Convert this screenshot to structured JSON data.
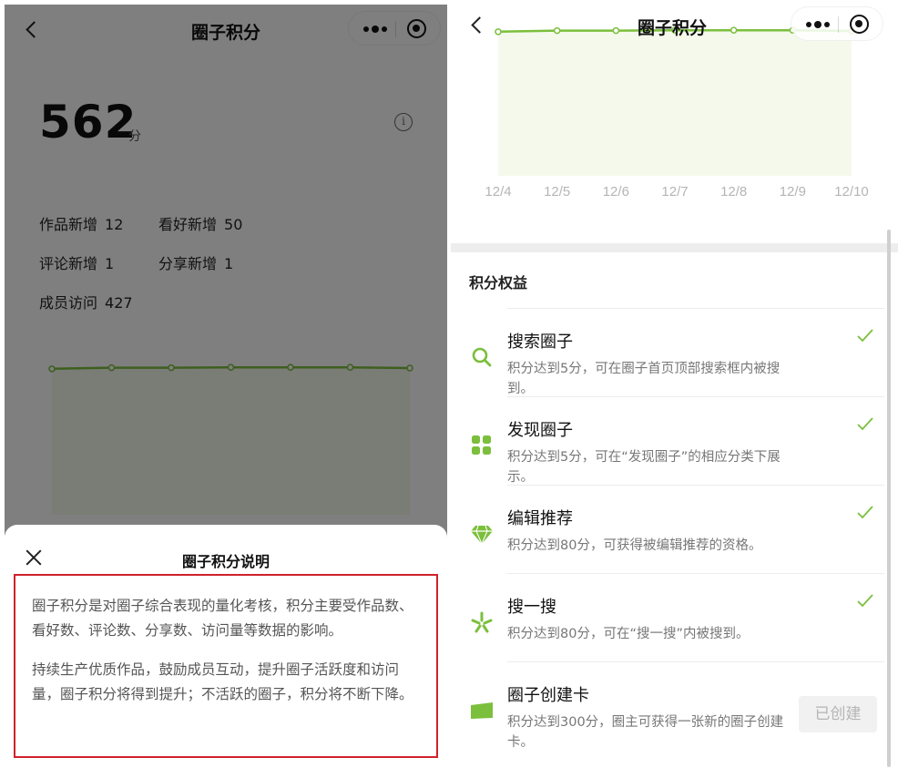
{
  "left": {
    "header": {
      "title": "圈子积分"
    },
    "score": {
      "value": "562",
      "unit": "分"
    },
    "info_icon": "info-icon",
    "stats": [
      {
        "label": "作品新增",
        "value": "12"
      },
      {
        "label": "看好新增",
        "value": "50"
      },
      {
        "label": "评论新增",
        "value": "1"
      },
      {
        "label": "分享新增",
        "value": "1"
      },
      {
        "label": "成员访问",
        "value": "427"
      }
    ],
    "sheet": {
      "title": "圈子积分说明",
      "paragraphs": [
        "圈子积分是对圈子综合表现的量化考核，积分主要受作品数、看好数、评论数、分享数、访问量等数据的影响。",
        "持续生产优质作品，鼓励成员互动，提升圈子活跃度和访问量，圈子积分将得到提升；不活跃的圈子，积分将不断下降。"
      ]
    }
  },
  "right": {
    "header": {
      "title": "圈子积分"
    },
    "section_title": "积分权益",
    "benefits": [
      {
        "title": "搜索圈子",
        "desc": "积分达到5分，可在圈子首页顶部搜索框内被搜到。",
        "icon": "search-icon",
        "status": "check"
      },
      {
        "title": "发现圈子",
        "desc": "积分达到5分，可在“发现圈子”的相应分类下展示。",
        "icon": "grid-icon",
        "status": "check"
      },
      {
        "title": "编辑推荐",
        "desc": "积分达到80分，可获得被编辑推荐的资格。",
        "icon": "diamond-icon",
        "status": "check"
      },
      {
        "title": "搜一搜",
        "desc": "积分达到80分，可在“搜一搜”内被搜到。",
        "icon": "sparkle-icon",
        "status": "check"
      },
      {
        "title": "圈子创建卡",
        "desc": "积分达到300分，圈主可获得一张新的圈子创建卡。",
        "icon": "card-icon",
        "status": "button",
        "button_label": "已创建"
      }
    ]
  },
  "colors": {
    "accent": "#7bbf3c",
    "highlight_border": "#d0212a",
    "chart_fill": "#f4f9ec"
  },
  "chart_data": [
    {
      "type": "area",
      "categories": [
        "12/4",
        "12/5",
        "12/6",
        "12/7",
        "12/8",
        "12/9",
        "12/10"
      ],
      "series": [
        {
          "values": [
            560,
            563,
            563,
            564,
            564,
            564,
            562
          ]
        }
      ],
      "ylim": [
        0,
        600
      ],
      "grid": false,
      "color": "#7bbf3c",
      "fill": "#f4f9ec"
    }
  ]
}
